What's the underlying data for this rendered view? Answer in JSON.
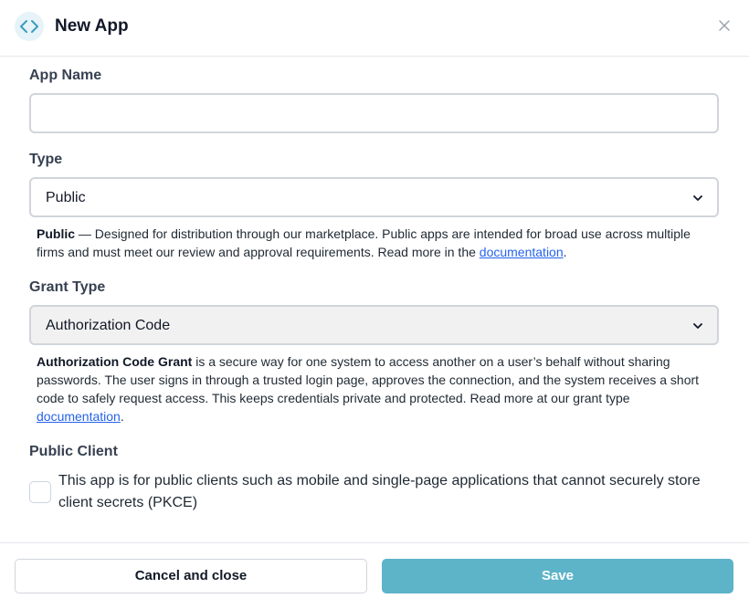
{
  "header": {
    "title": "New App"
  },
  "app_name": {
    "label": "App Name",
    "value": "",
    "placeholder": ""
  },
  "type": {
    "label": "Type",
    "selected": "Public",
    "help_bold": "Public",
    "help_text": " — Designed for distribution through our marketplace. Public apps are intended for broad use across multiple firms and must meet our review and approval requirements. Read more in the ",
    "help_link": "documentation",
    "help_end": "."
  },
  "grant_type": {
    "label": "Grant Type",
    "selected": "Authorization Code",
    "help_bold": "Authorization Code Grant",
    "help_text": " is a secure way for one system to access another on a user’s behalf without sharing passwords. The user signs in through a trusted login page, approves the connection, and the system receives a short code to safely request access. This keeps credentials private and protected. Read more at our grant type ",
    "help_link": "documentation",
    "help_end": "."
  },
  "public_client": {
    "label": "Public Client",
    "checkbox_label": "This app is for public clients such as mobile and single-page applications that cannot securely store client secrets (PKCE)",
    "checked": false
  },
  "footer": {
    "cancel_label": "Cancel and close",
    "save_label": "Save"
  },
  "colors": {
    "accent": "#5db3c8",
    "link": "#2563eb",
    "icon_bg": "#e6f3f8"
  },
  "icons": {
    "app": "code-brackets-icon",
    "close": "close-icon",
    "dropdown": "chevron-down-icon"
  }
}
